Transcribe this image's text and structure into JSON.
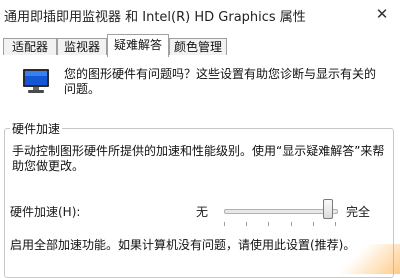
{
  "window": {
    "title": "通用即插即用监视器 和 Intel(R) HD Graphics 属性",
    "close_glyph": "✕"
  },
  "tabs": [
    {
      "label": "适配器",
      "active": false
    },
    {
      "label": "监视器",
      "active": false
    },
    {
      "label": "疑难解答",
      "active": true
    },
    {
      "label": "颜色管理",
      "active": false
    }
  ],
  "intro": {
    "text": "您的图形硬件有问题吗？这些设置有助您诊断与显示有关的问题。",
    "icon": "monitor-icon"
  },
  "hardware_acceleration": {
    "legend": "硬件加速",
    "description": "手动控制图形硬件所提供的加速和性能级别。使用“显示疑难解答”来帮助您做更改。",
    "slider_label": "硬件加速(H):",
    "min_label": "无",
    "max_label": "完全",
    "slider_value_fraction": 1.0,
    "tick_count": 6,
    "level_description": "启用全部加速功能。如果计算机没有问题，请使用此设置(推荐)。"
  },
  "colors": {
    "accent": "#0a64d8",
    "border": "#a0a0a0"
  }
}
